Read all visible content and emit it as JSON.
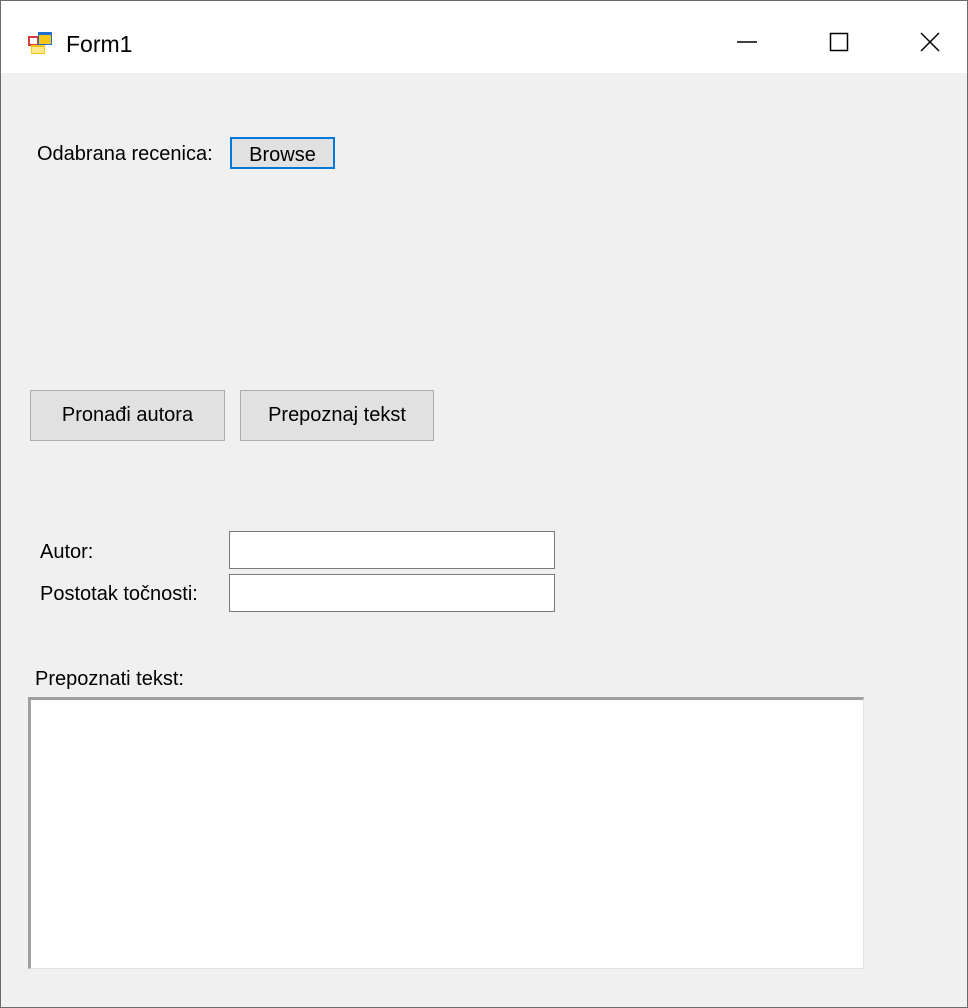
{
  "window": {
    "title": "Form1",
    "icon": "form-app-icon",
    "controls": {
      "minimize": "minimize-icon",
      "maximize": "maximize-icon",
      "close": "close-icon"
    }
  },
  "form": {
    "odabrana_label": "Odabrana recenica:",
    "browse_label": "Browse",
    "pronadi_label": "Pronađi autora",
    "prepoznaj_label": "Prepoznaj tekst",
    "autor_label": "Autor:",
    "autor_value": "",
    "postotak_label": "Postotak točnosti:",
    "postotak_value": "",
    "prepoznati_label": "Prepoznati tekst:",
    "prepoznati_value": ""
  },
  "colors": {
    "form_background": "#f0f0f0",
    "titlebar": "#ffffff",
    "focus_accent": "#0078d7",
    "button_face": "#e1e1e1"
  }
}
